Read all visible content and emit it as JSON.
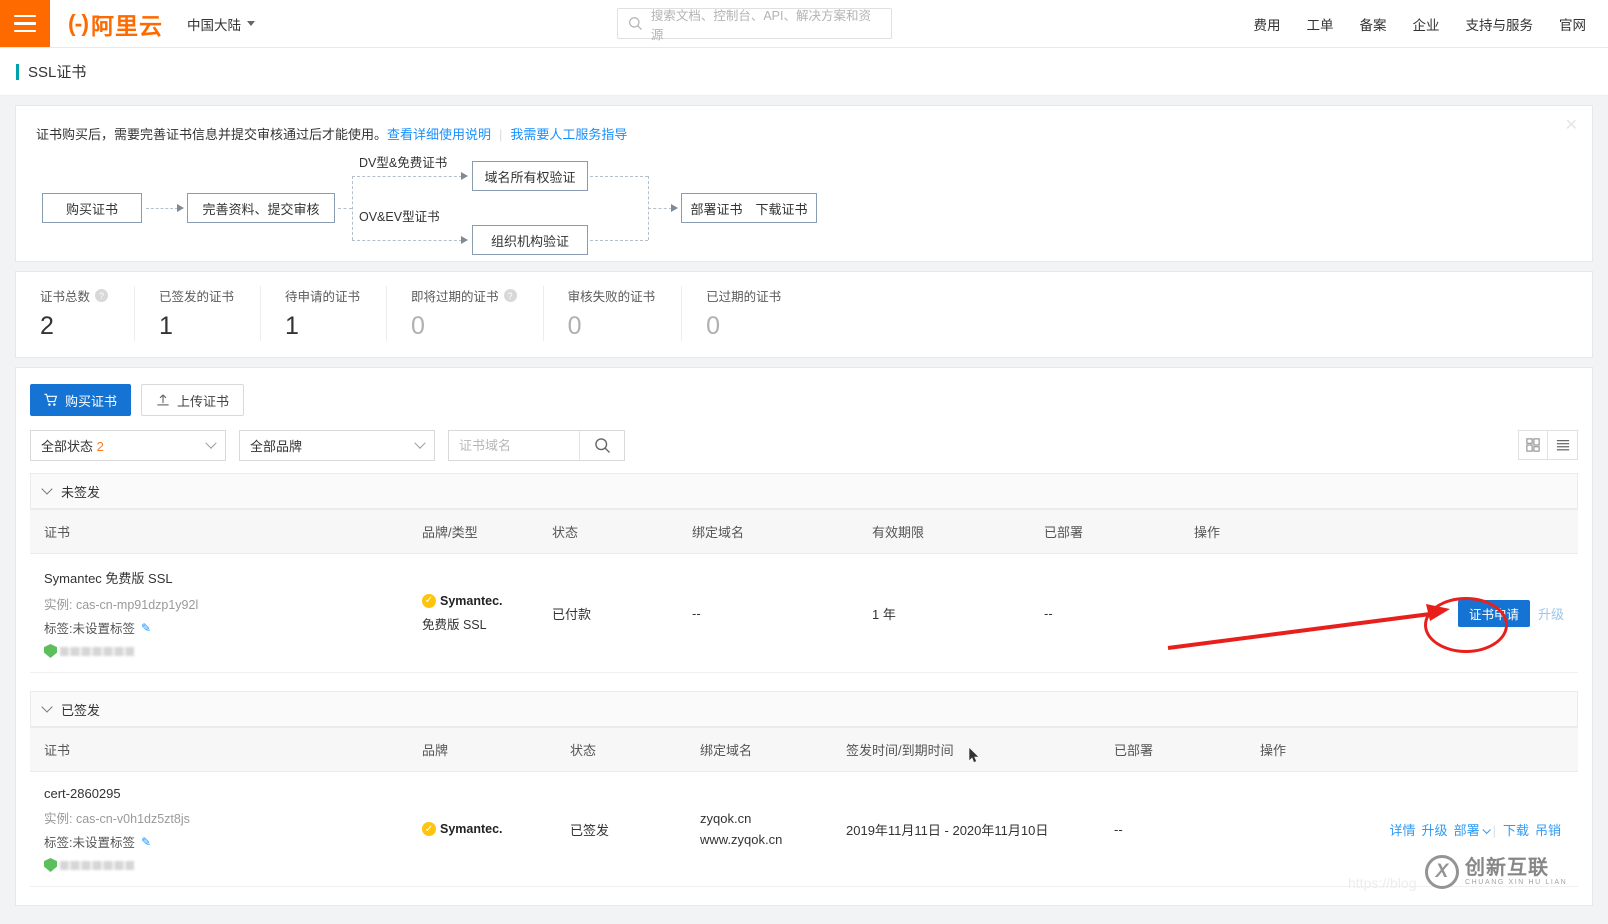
{
  "topnav": {
    "menu_icon": "hamburger-icon",
    "logo_mark": "(-)",
    "logo_text": "阿里云",
    "region": "中国大陆",
    "search_placeholder": "搜索文档、控制台、API、解决方案和资源",
    "search_icon": "search-icon",
    "links": [
      "费用",
      "工单",
      "备案",
      "企业",
      "支持与服务",
      "官网"
    ]
  },
  "page": {
    "title": "SSL证书"
  },
  "notice": {
    "text": "证书购买后，需要完善证书信息并提交审核通过后才能使用。",
    "link1": "查看详细使用说明",
    "link2": "我需要人工服务指导",
    "close_icon": "close-icon"
  },
  "flow": {
    "nodes": [
      {
        "label": "购买证书"
      },
      {
        "label": "完善资料、提交审核"
      },
      {
        "label": "域名所有权验证"
      },
      {
        "label": "组织机构验证"
      },
      {
        "label": "部署证书　下载证书"
      }
    ],
    "branch_labels": [
      "DV型&免费证书",
      "OV&EV型证书"
    ]
  },
  "stats": [
    {
      "label": "证书总数",
      "value": "2",
      "has_help": true,
      "zero": false
    },
    {
      "label": "已签发的证书",
      "value": "1",
      "has_help": false,
      "zero": false
    },
    {
      "label": "待申请的证书",
      "value": "1",
      "has_help": false,
      "zero": false
    },
    {
      "label": "即将过期的证书",
      "value": "0",
      "has_help": true,
      "zero": true
    },
    {
      "label": "审核失败的证书",
      "value": "0",
      "has_help": false,
      "zero": true
    },
    {
      "label": "已过期的证书",
      "value": "0",
      "has_help": false,
      "zero": true
    }
  ],
  "toolbar": {
    "buy_label": "购买证书",
    "buy_icon": "cart-icon",
    "upload_label": "上传证书",
    "upload_icon": "upload-icon"
  },
  "filters": {
    "status_label": "全部状态",
    "status_count": "2",
    "brand_label": "全部品牌",
    "domain_placeholder": "证书域名",
    "domain_value": "",
    "search_icon": "search-icon",
    "grid_view_icon": "grid-view-icon",
    "list_view_icon": "list-view-icon"
  },
  "groups": [
    {
      "title": "未签发",
      "columns": [
        "证书",
        "品牌/类型",
        "状态",
        "绑定域名",
        "有效期限",
        "已部署",
        "",
        "操作"
      ],
      "rows": [
        {
          "cert_name": "Symantec 免费版 SSL",
          "instance": "实例: cas-cn-mp91dzp1y92l",
          "tag": "标签:未设置标签",
          "brand": "Symantec.",
          "brand_type": "免费版 SSL",
          "status": "已付款",
          "domain": "--",
          "validity": "1 年",
          "deployed": "--",
          "primary_action": "证书申请",
          "secondary_action": "升级"
        }
      ]
    },
    {
      "title": "已签发",
      "columns": [
        "证书",
        "品牌",
        "状态",
        "绑定域名",
        "签发时间/到期时间",
        "已部署",
        "",
        "操作"
      ],
      "rows": [
        {
          "cert_name": "cert-2860295",
          "instance": "实例: cas-cn-v0h1dz5zt8js",
          "tag": "标签:未设置标签",
          "brand": "Symantec.",
          "status": "已签发",
          "domain_line1": "zyqok.cn",
          "domain_line2": "www.zyqok.cn",
          "dates": "2019年11月11日 - 2020年11月10日",
          "deployed": "--",
          "actions": [
            "详情",
            "升级",
            "部署"
          ],
          "actions_tail": [
            "下载",
            "吊销"
          ]
        }
      ]
    }
  ],
  "annotations": {
    "highlight_color": "#e8201c",
    "target": "证书申请"
  },
  "watermark": {
    "url": "https://blog",
    "brand_cn": "创新互联",
    "brand_py": "CHUANG XIN HU LIAN",
    "logo_letter": "X"
  }
}
